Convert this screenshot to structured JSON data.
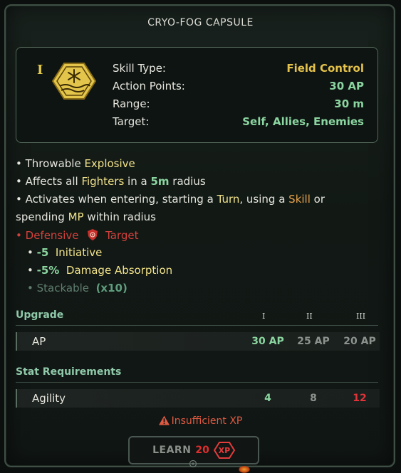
{
  "title": "CRYO-FOG CAPSULE",
  "rank_glyph": "I",
  "info": {
    "skill_type_label": "Skill Type:",
    "skill_type_value": "Field Control",
    "action_points_label": "Action Points:",
    "action_points_value": "30 AP",
    "range_label": "Range:",
    "range_value": "30 m",
    "target_label": "Target:",
    "target_value": "Self, Allies, Enemies"
  },
  "description": {
    "line1_a": "• Throwable ",
    "line1_kw": "Explosive",
    "line2_a": "• Affects all ",
    "line2_kw": "Fighters",
    "line2_b": " in a ",
    "line2_num": "5m",
    "line2_c": " radius",
    "line3_a": "• Activates when entering, starting a ",
    "line3_kw1": "Turn",
    "line3_b": ", using a ",
    "line3_kw2": "Skill",
    "line3_c": " or",
    "line4_a": "spending ",
    "line4_kw": "MP",
    "line4_b": " within radius",
    "defensive_bullet": "•",
    "defensive_label": "Defensive",
    "defensive_target": "Target",
    "effect1_bullet": "•",
    "effect1_value": "-5",
    "effect1_label": "Initiative",
    "effect2_bullet": "•",
    "effect2_value": "-5%",
    "effect2_label": "Damage Absorption",
    "effect3_bullet": "•",
    "effect3_label": "Stackable",
    "effect3_value": "(x10)"
  },
  "upgrade": {
    "title": "Upgrade",
    "ranks": [
      "I",
      "II",
      "III"
    ],
    "row_label": "AP",
    "values": [
      "30 AP",
      "25 AP",
      "20 AP"
    ]
  },
  "stat_requirements": {
    "title": "Stat Requirements",
    "row_label": "Agility",
    "values": [
      "4",
      "8",
      "12"
    ]
  },
  "warning": {
    "icon": "warning-triangle-icon",
    "text": "Insufficient XP"
  },
  "learn_button": {
    "label": "LEARN",
    "cost": "20",
    "currency": "XP"
  },
  "colors": {
    "accent_green": "#8bd5a0",
    "accent_yellow": "#e4c24b",
    "danger_red": "#d3403b"
  }
}
